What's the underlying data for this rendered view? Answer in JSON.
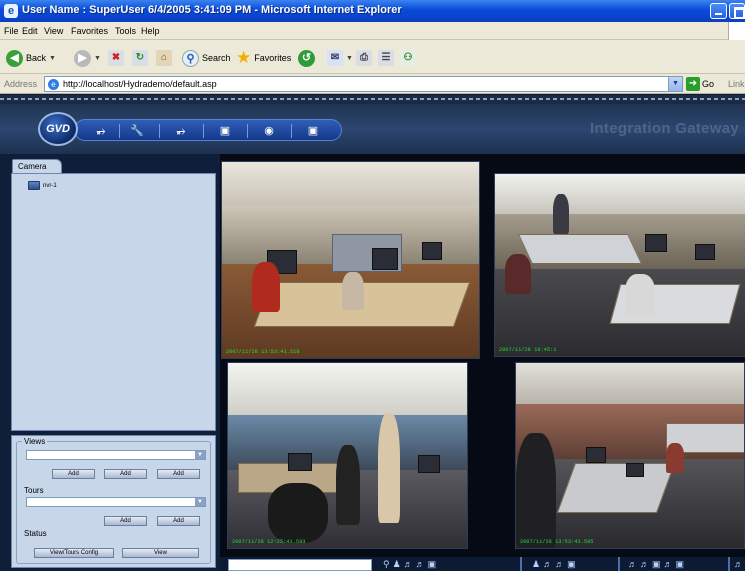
{
  "window": {
    "title": "User Name : SuperUser 6/4/2005 3:41:09 PM - Microsoft Internet Explorer"
  },
  "menu": [
    "File",
    "Edit",
    "View",
    "Favorites",
    "Tools",
    "Help"
  ],
  "toolbar": {
    "back_label": "Back",
    "search_label": "Search",
    "favorites_label": "Favorites"
  },
  "address_bar": {
    "label": "Address",
    "url": "http://localhost/Hydrademo/default.asp",
    "go_label": "Go",
    "links_label": "Links"
  },
  "app": {
    "logo_text": "GVD",
    "product_title": "Integration Gateway",
    "nav_icons": [
      "signal-icon",
      "wrench-icon",
      "signal-icon",
      "monitor-icon",
      "eye-icon",
      "monitor-icon"
    ]
  },
  "camera_panel": {
    "tab_label": "Camera",
    "tree_items": [
      "nvr-1"
    ]
  },
  "controls": {
    "views_label": "Views",
    "tours_label": "Tours",
    "status_label": "Status",
    "add_label": "Add",
    "view_tours_config_label": "View/Tours Config",
    "view_label": "View"
  },
  "feeds": [
    {
      "timestamp": "2007/11/28 13:53:41.518"
    },
    {
      "timestamp": "2007/11/28 16:45:1"
    },
    {
      "timestamp": "2007/11/28 12:25:41.593"
    },
    {
      "timestamp": "2007/11/28 13:53:41.595"
    }
  ]
}
